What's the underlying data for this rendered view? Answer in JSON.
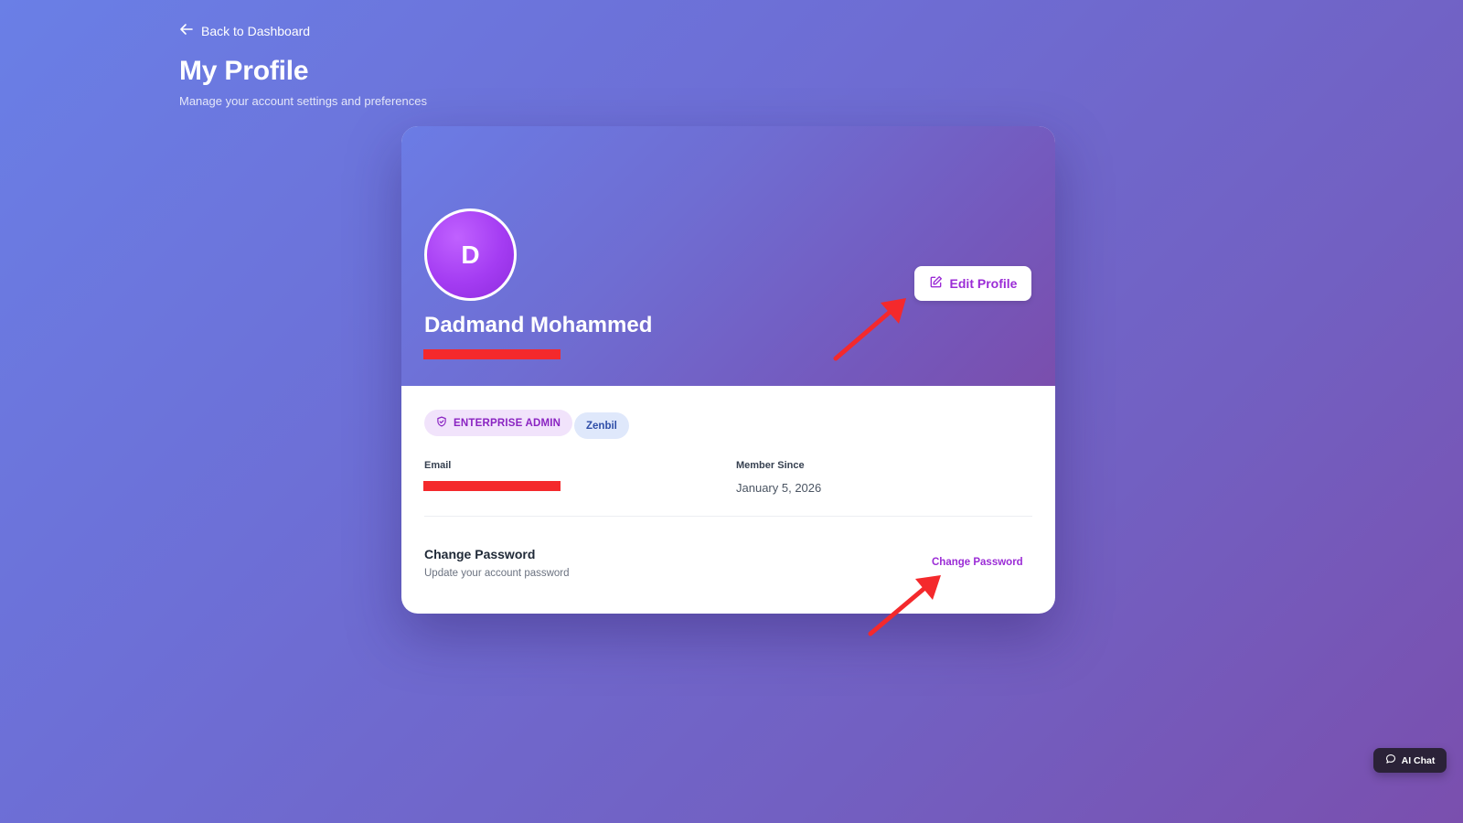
{
  "header": {
    "back_label": "Back to Dashboard",
    "title": "My Profile",
    "subtitle": "Manage your account settings and preferences"
  },
  "profile": {
    "avatar_initial": "D",
    "name": "Dadmand Mohammed",
    "edit_label": "Edit Profile",
    "role_badge": "ENTERPRISE ADMIN",
    "org_badge": "Zenbil"
  },
  "details": {
    "email_label": "Email",
    "member_since_label": "Member Since",
    "member_since_value": "January 5, 2026"
  },
  "password": {
    "title": "Change Password",
    "subtitle": "Update your account password",
    "link_label": "Change Password"
  },
  "ai_chat": {
    "label": "AI Chat"
  },
  "icons": {
    "back": "arrow-left-icon",
    "edit": "edit-pencil-icon",
    "role": "shield-icon",
    "chat": "chat-bubble-icon"
  },
  "colors": {
    "accent": "#9b2cd6",
    "annotation": "#f4292c",
    "redaction": "#f4292c"
  }
}
